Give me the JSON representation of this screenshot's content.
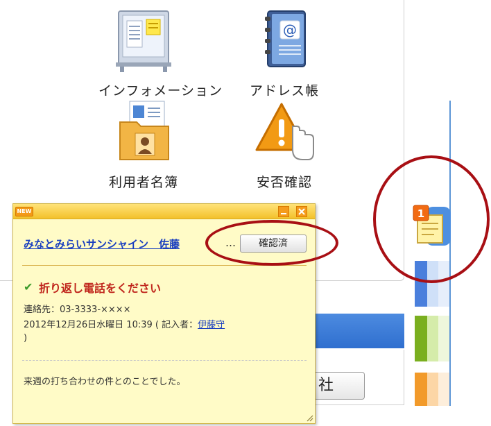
{
  "apps": [
    {
      "label": "インフォメーション",
      "icon": "bulletin-board-icon"
    },
    {
      "label": "アドレス帳",
      "icon": "address-book-icon"
    },
    {
      "label": "利用者名簿",
      "icon": "user-directory-folder-icon"
    },
    {
      "label": "安否確認",
      "icon": "safety-check-warning-icon"
    }
  ],
  "popup": {
    "badge": "NEW",
    "sender": "みなとみらいサンシャイン　佐藤",
    "ellipsis": "…",
    "confirm_label": "確認済",
    "subject": "折り返し電話をください",
    "contact": "連絡先：03-3333-××××",
    "datetime_prefix": "2012年12月26日水曜日 10:39 ( 記入者：",
    "author": "伊藤守",
    "paren_close": ")",
    "message": "来週の打ち合わせの件とのことでした。"
  },
  "background": {
    "company_button_label": "社"
  },
  "rail": {
    "notification_count": "1"
  },
  "colors": {
    "accent_blue": "#2f6fcf",
    "annotation_red": "#a80f14",
    "note_yellow": "#fffbc7",
    "subject_red": "#c0261d"
  }
}
